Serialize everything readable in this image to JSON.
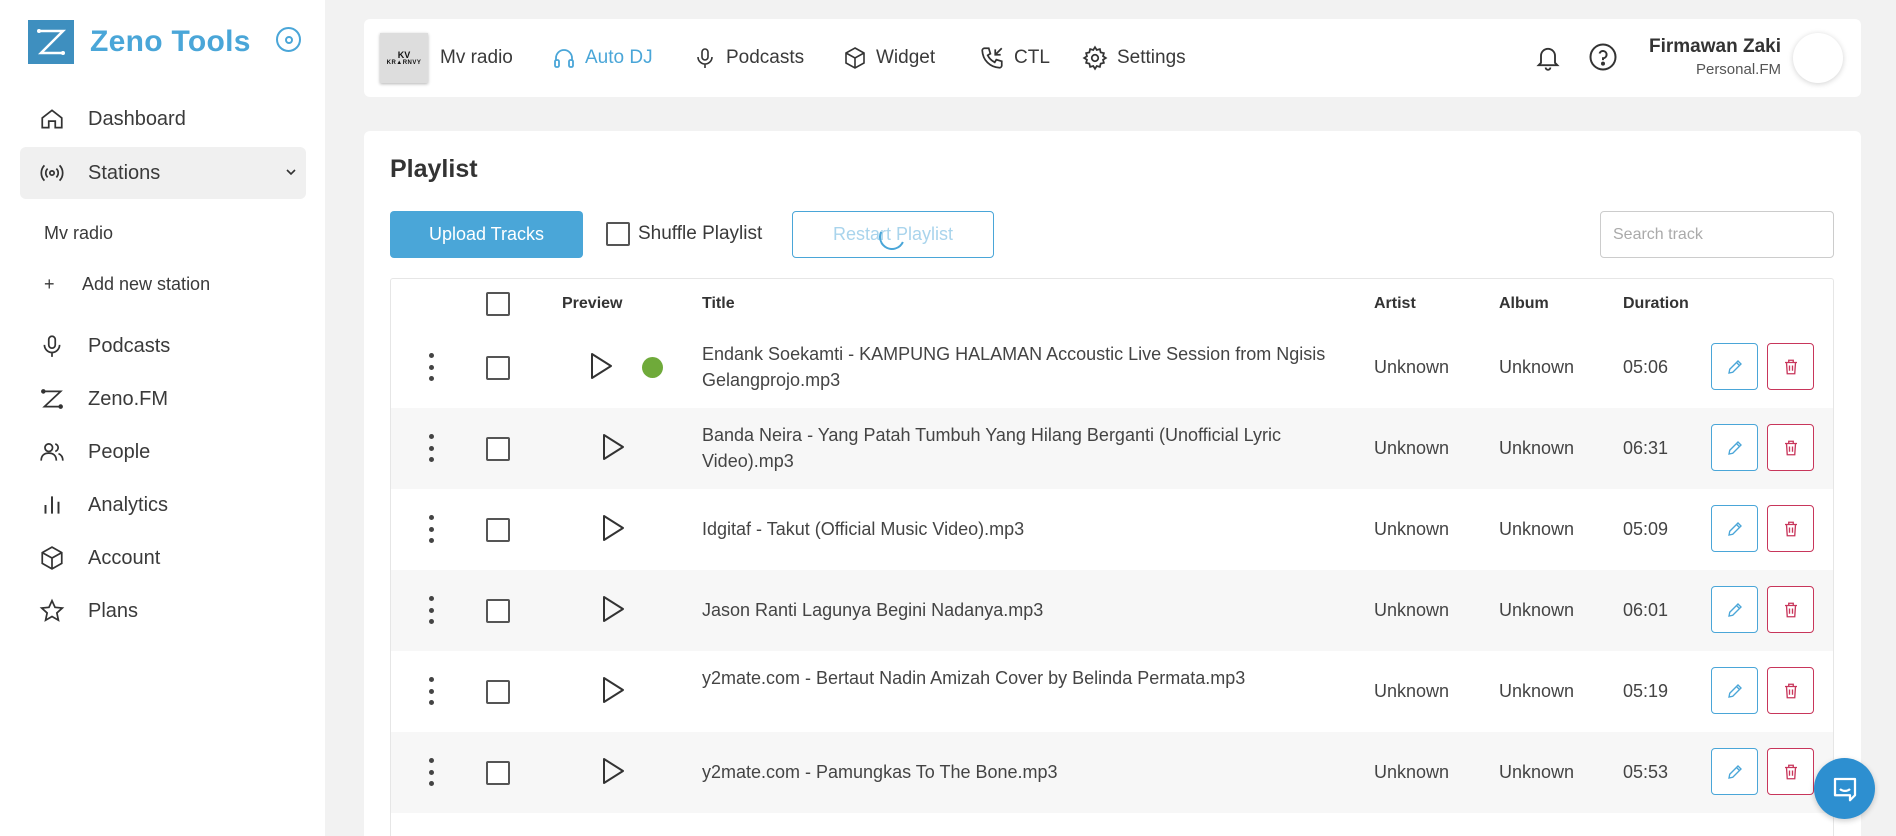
{
  "brand": {
    "name": "Zeno Tools"
  },
  "sidebar": {
    "items": [
      {
        "label": "Dashboard"
      },
      {
        "label": "Stations"
      },
      {
        "label": "Podcasts"
      },
      {
        "label": "Zeno.FM"
      },
      {
        "label": "People"
      },
      {
        "label": "Analytics"
      },
      {
        "label": "Account"
      },
      {
        "label": "Plans"
      }
    ],
    "stations_sub": {
      "station": "Mv radio",
      "add": "Add new station",
      "plus": "+"
    }
  },
  "topbar": {
    "station_name": "Mv radio",
    "station_thumb_top": "KV",
    "station_thumb_bottom": "KR▲RNVY",
    "nav": [
      {
        "label": "Auto DJ"
      },
      {
        "label": "Podcasts"
      },
      {
        "label": "Widget"
      },
      {
        "label": "CTL"
      },
      {
        "label": "Settings"
      }
    ],
    "user": {
      "name": "Firmawan Zaki",
      "plan": "Personal.FM"
    }
  },
  "playlist": {
    "title": "Playlist",
    "upload_label": "Upload Tracks",
    "shuffle_label": "Shuffle Playlist",
    "restart_label": "Restart Playlist",
    "search_placeholder": "Search track",
    "columns": {
      "preview": "Preview",
      "title": "Title",
      "artist": "Artist",
      "album": "Album",
      "duration": "Duration"
    },
    "tracks": [
      {
        "title": "Endank Soekamti - KAMPUNG HALAMAN Accoustic Live Session from Ngisis Gelangprojo.mp3",
        "artist": "Unknown",
        "album": "Unknown",
        "duration": "05:06",
        "playing": true
      },
      {
        "title": "Banda Neira - Yang Patah Tumbuh Yang Hilang Berganti (Unofficial Lyric Video).mp3",
        "artist": "Unknown",
        "album": "Unknown",
        "duration": "06:31",
        "playing": false
      },
      {
        "title": "Idgitaf - Takut (Official Music Video).mp3",
        "artist": "Unknown",
        "album": "Unknown",
        "duration": "05:09",
        "playing": false
      },
      {
        "title": "Jason Ranti Lagunya Begini Nadanya.mp3",
        "artist": "Unknown",
        "album": "Unknown",
        "duration": "06:01",
        "playing": false
      },
      {
        "title": "y2mate.com - Bertaut Nadin Amizah Cover by Belinda Permata.mp3",
        "artist": "Unknown",
        "album": "Unknown",
        "duration": "05:19",
        "playing": false
      },
      {
        "title": "y2mate.com - Pamungkas To The Bone.mp3",
        "artist": "Unknown",
        "album": "Unknown",
        "duration": "05:53",
        "playing": false
      }
    ]
  },
  "colors": {
    "accent": "#4aa6d8",
    "danger": "#c8365b",
    "live": "#6faa3a",
    "chat": "#2d8fd0"
  }
}
